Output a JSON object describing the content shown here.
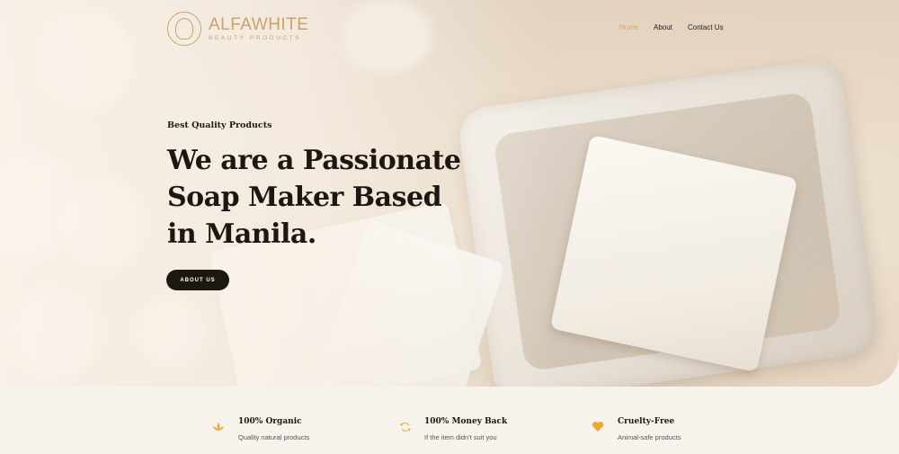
{
  "brand": {
    "name": "ALFAWHITE",
    "tagline": "BEAUTY PRODUCTS"
  },
  "nav": {
    "items": [
      {
        "label": "Home",
        "active": true
      },
      {
        "label": "About"
      },
      {
        "label": "Contact Us"
      }
    ]
  },
  "hero": {
    "eyebrow": "Best Quality Products",
    "headline": "We are a Passionate Soap Maker Based in Manila.",
    "cta_label": "ABOUT US"
  },
  "features": [
    {
      "icon": "lotus-icon",
      "title": "100% Organic",
      "description": "Quality natural products"
    },
    {
      "icon": "refresh-icon",
      "title": "100% Money Back",
      "description": "If the item didn't suit you"
    },
    {
      "icon": "heart-icon",
      "title": "Cruelty-Free",
      "description": "Animal-safe products"
    }
  ],
  "colors": {
    "accent": "#c9a36a",
    "nav_active": "#d9a45b",
    "dark": "#1d1712",
    "icon": "#e9a935",
    "background": "#f7f3ec"
  }
}
